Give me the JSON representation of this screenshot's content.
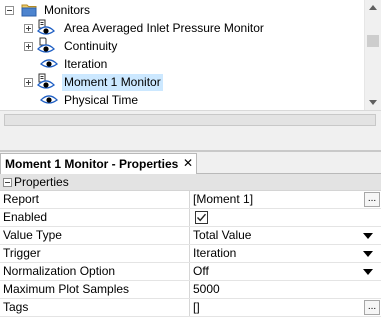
{
  "tree": {
    "items": [
      {
        "label": "Monitors",
        "expanded": true,
        "icon": "folder-icon"
      },
      {
        "label": "Area Averaged Inlet Pressure Monitor",
        "icon": "monitor-eye-icon"
      },
      {
        "label": "Continuity",
        "icon": "monitor-eye-icon"
      },
      {
        "label": "Iteration",
        "icon": "eye-icon"
      },
      {
        "label": "Moment 1 Monitor",
        "icon": "monitor-eye-icon",
        "selected": true
      },
      {
        "label": "Physical Time",
        "icon": "eye-icon"
      }
    ]
  },
  "properties_panel": {
    "tab_title": "Moment 1 Monitor - Properties",
    "close_glyph": "✕",
    "section_title": "Properties",
    "rows": [
      {
        "name": "Report",
        "value": "[Moment 1]",
        "control": "ellipsis"
      },
      {
        "name": "Enabled",
        "value": "",
        "control": "checkbox",
        "checked": true
      },
      {
        "name": "Value Type",
        "value": "Total Value",
        "control": "dropdown"
      },
      {
        "name": "Trigger",
        "value": "Iteration",
        "control": "dropdown"
      },
      {
        "name": "Normalization Option",
        "value": "Off",
        "control": "dropdown"
      },
      {
        "name": "Maximum Plot Samples",
        "value": "5000",
        "control": "none"
      },
      {
        "name": "Tags",
        "value": "[]",
        "control": "ellipsis"
      }
    ],
    "ellipsis_label": "..."
  },
  "colors": {
    "selection": "#cce8ff",
    "eye_blue": "#1f5fc4",
    "section_header_bg": "#e3e3e3"
  }
}
